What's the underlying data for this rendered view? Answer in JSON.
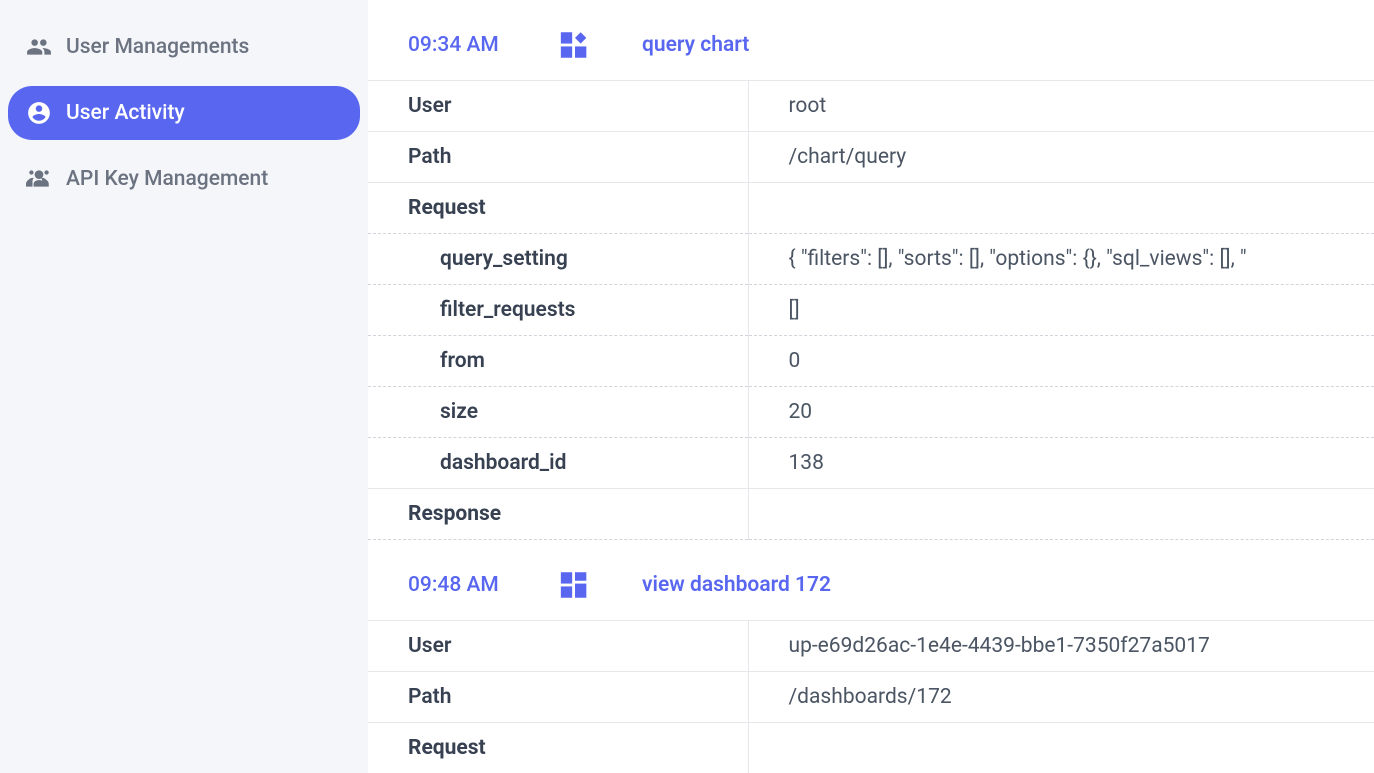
{
  "sidebar": {
    "items": [
      {
        "label": "User Managements",
        "icon": "users-icon"
      },
      {
        "label": "User Activity",
        "icon": "activity-icon"
      },
      {
        "label": "API Key Management",
        "icon": "api-key-icon"
      }
    ],
    "active_index": 1
  },
  "entries": [
    {
      "time": "09:34 AM",
      "action": "query chart",
      "icon": "chart-icon",
      "details": {
        "user_label": "User",
        "user_value": "root",
        "path_label": "Path",
        "path_value": "/chart/query",
        "request_label": "Request",
        "request_params": [
          {
            "key": "query_setting",
            "value": "{ \"filters\": [], \"sorts\": [], \"options\": {}, \"sql_views\": [], \""
          },
          {
            "key": "filter_requests",
            "value": "[]"
          },
          {
            "key": "from",
            "value": "0"
          },
          {
            "key": "size",
            "value": "20"
          },
          {
            "key": "dashboard_id",
            "value": "138"
          }
        ],
        "response_label": "Response"
      }
    },
    {
      "time": "09:48 AM",
      "action": "view dashboard 172",
      "icon": "dashboard-icon",
      "details": {
        "user_label": "User",
        "user_value": "up-e69d26ac-1e4e-4439-bbe1-7350f27a5017",
        "path_label": "Path",
        "path_value": "/dashboards/172",
        "request_label": "Request",
        "request_params": [],
        "response_label": ""
      }
    }
  ]
}
